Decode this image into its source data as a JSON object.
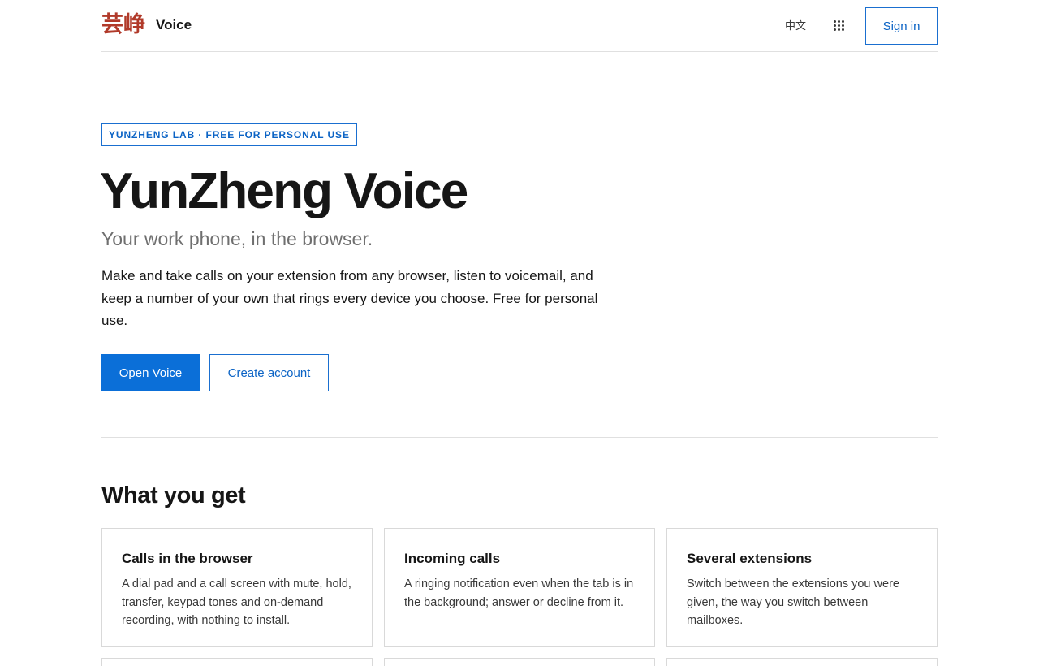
{
  "header": {
    "logo_text": "芸峥",
    "brand_name": "Voice",
    "language_label": "中文",
    "apps_icon": "apps-grid-icon",
    "signin_label": "Sign in"
  },
  "hero": {
    "tag": "YUNZHENG LAB · FREE FOR PERSONAL USE",
    "title": "YunZheng Voice",
    "subtitle": "Your work phone, in the browser.",
    "description": "Make and take calls on your extension from any browser, listen to voicemail, and keep a number of your own that rings every device you choose. Free for personal use.",
    "primary_button": "Open Voice",
    "secondary_button": "Create account"
  },
  "features": {
    "title": "What you get",
    "cards": [
      {
        "title": "Calls in the browser",
        "description": "A dial pad and a call screen with mute, hold, transfer, keypad tones and on-demand recording, with nothing to install."
      },
      {
        "title": "Incoming calls",
        "description": "A ringing notification even when the tab is in the background; answer or decline from it."
      },
      {
        "title": "Several extensions",
        "description": "Switch between the extensions you were given, the way you switch between mailboxes."
      }
    ]
  },
  "colors": {
    "accent": "#0b6fd8",
    "logo": "#b13a2a",
    "text": "#161616",
    "muted": "#6f6f6f"
  }
}
